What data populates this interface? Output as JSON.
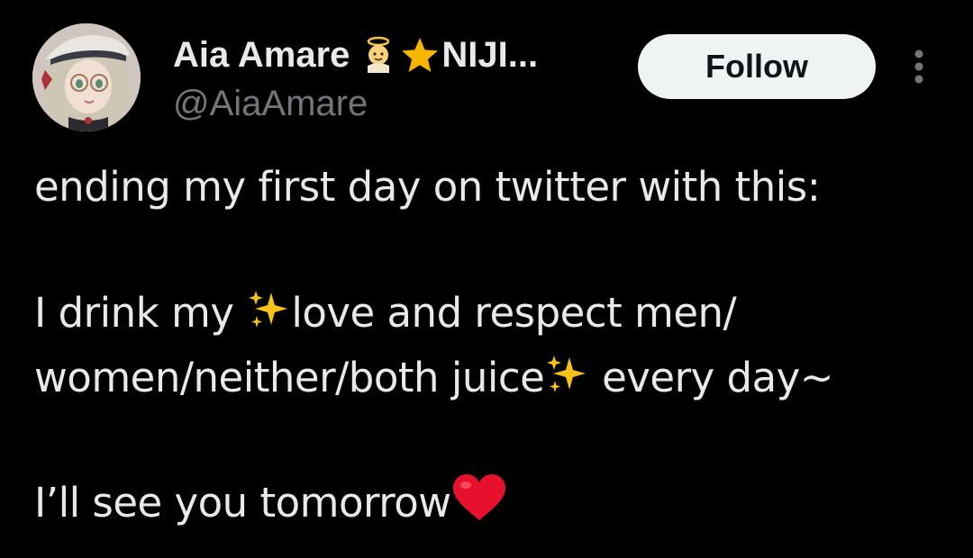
{
  "author": {
    "display_name": "Aia Amare",
    "name_emoji_1": "angel-baby-emoji",
    "name_emoji_2": "star-emoji",
    "name_suffix": "NIJI...",
    "handle": "@AiaAmare"
  },
  "actions": {
    "follow_label": "Follow",
    "more_icon": "more-vertical-icon"
  },
  "tweet": {
    "line1": "ending my first day on twitter with this:",
    "line2_pre": "I drink my ",
    "line2_emoji": "sparkles-emoji",
    "line2_post": "love and respect men/",
    "line3_pre": "women/neither/both juice",
    "line3_emoji": "sparkles-emoji",
    "line3_post": " every day~",
    "line4_pre": "I’ll see you tomorrow",
    "line4_emoji": "red-heart-emoji"
  },
  "colors": {
    "background": "#000000",
    "text_primary": "#e7e9ea",
    "text_secondary": "#71767b",
    "follow_bg": "#eff3f4",
    "follow_text": "#0f1419"
  }
}
